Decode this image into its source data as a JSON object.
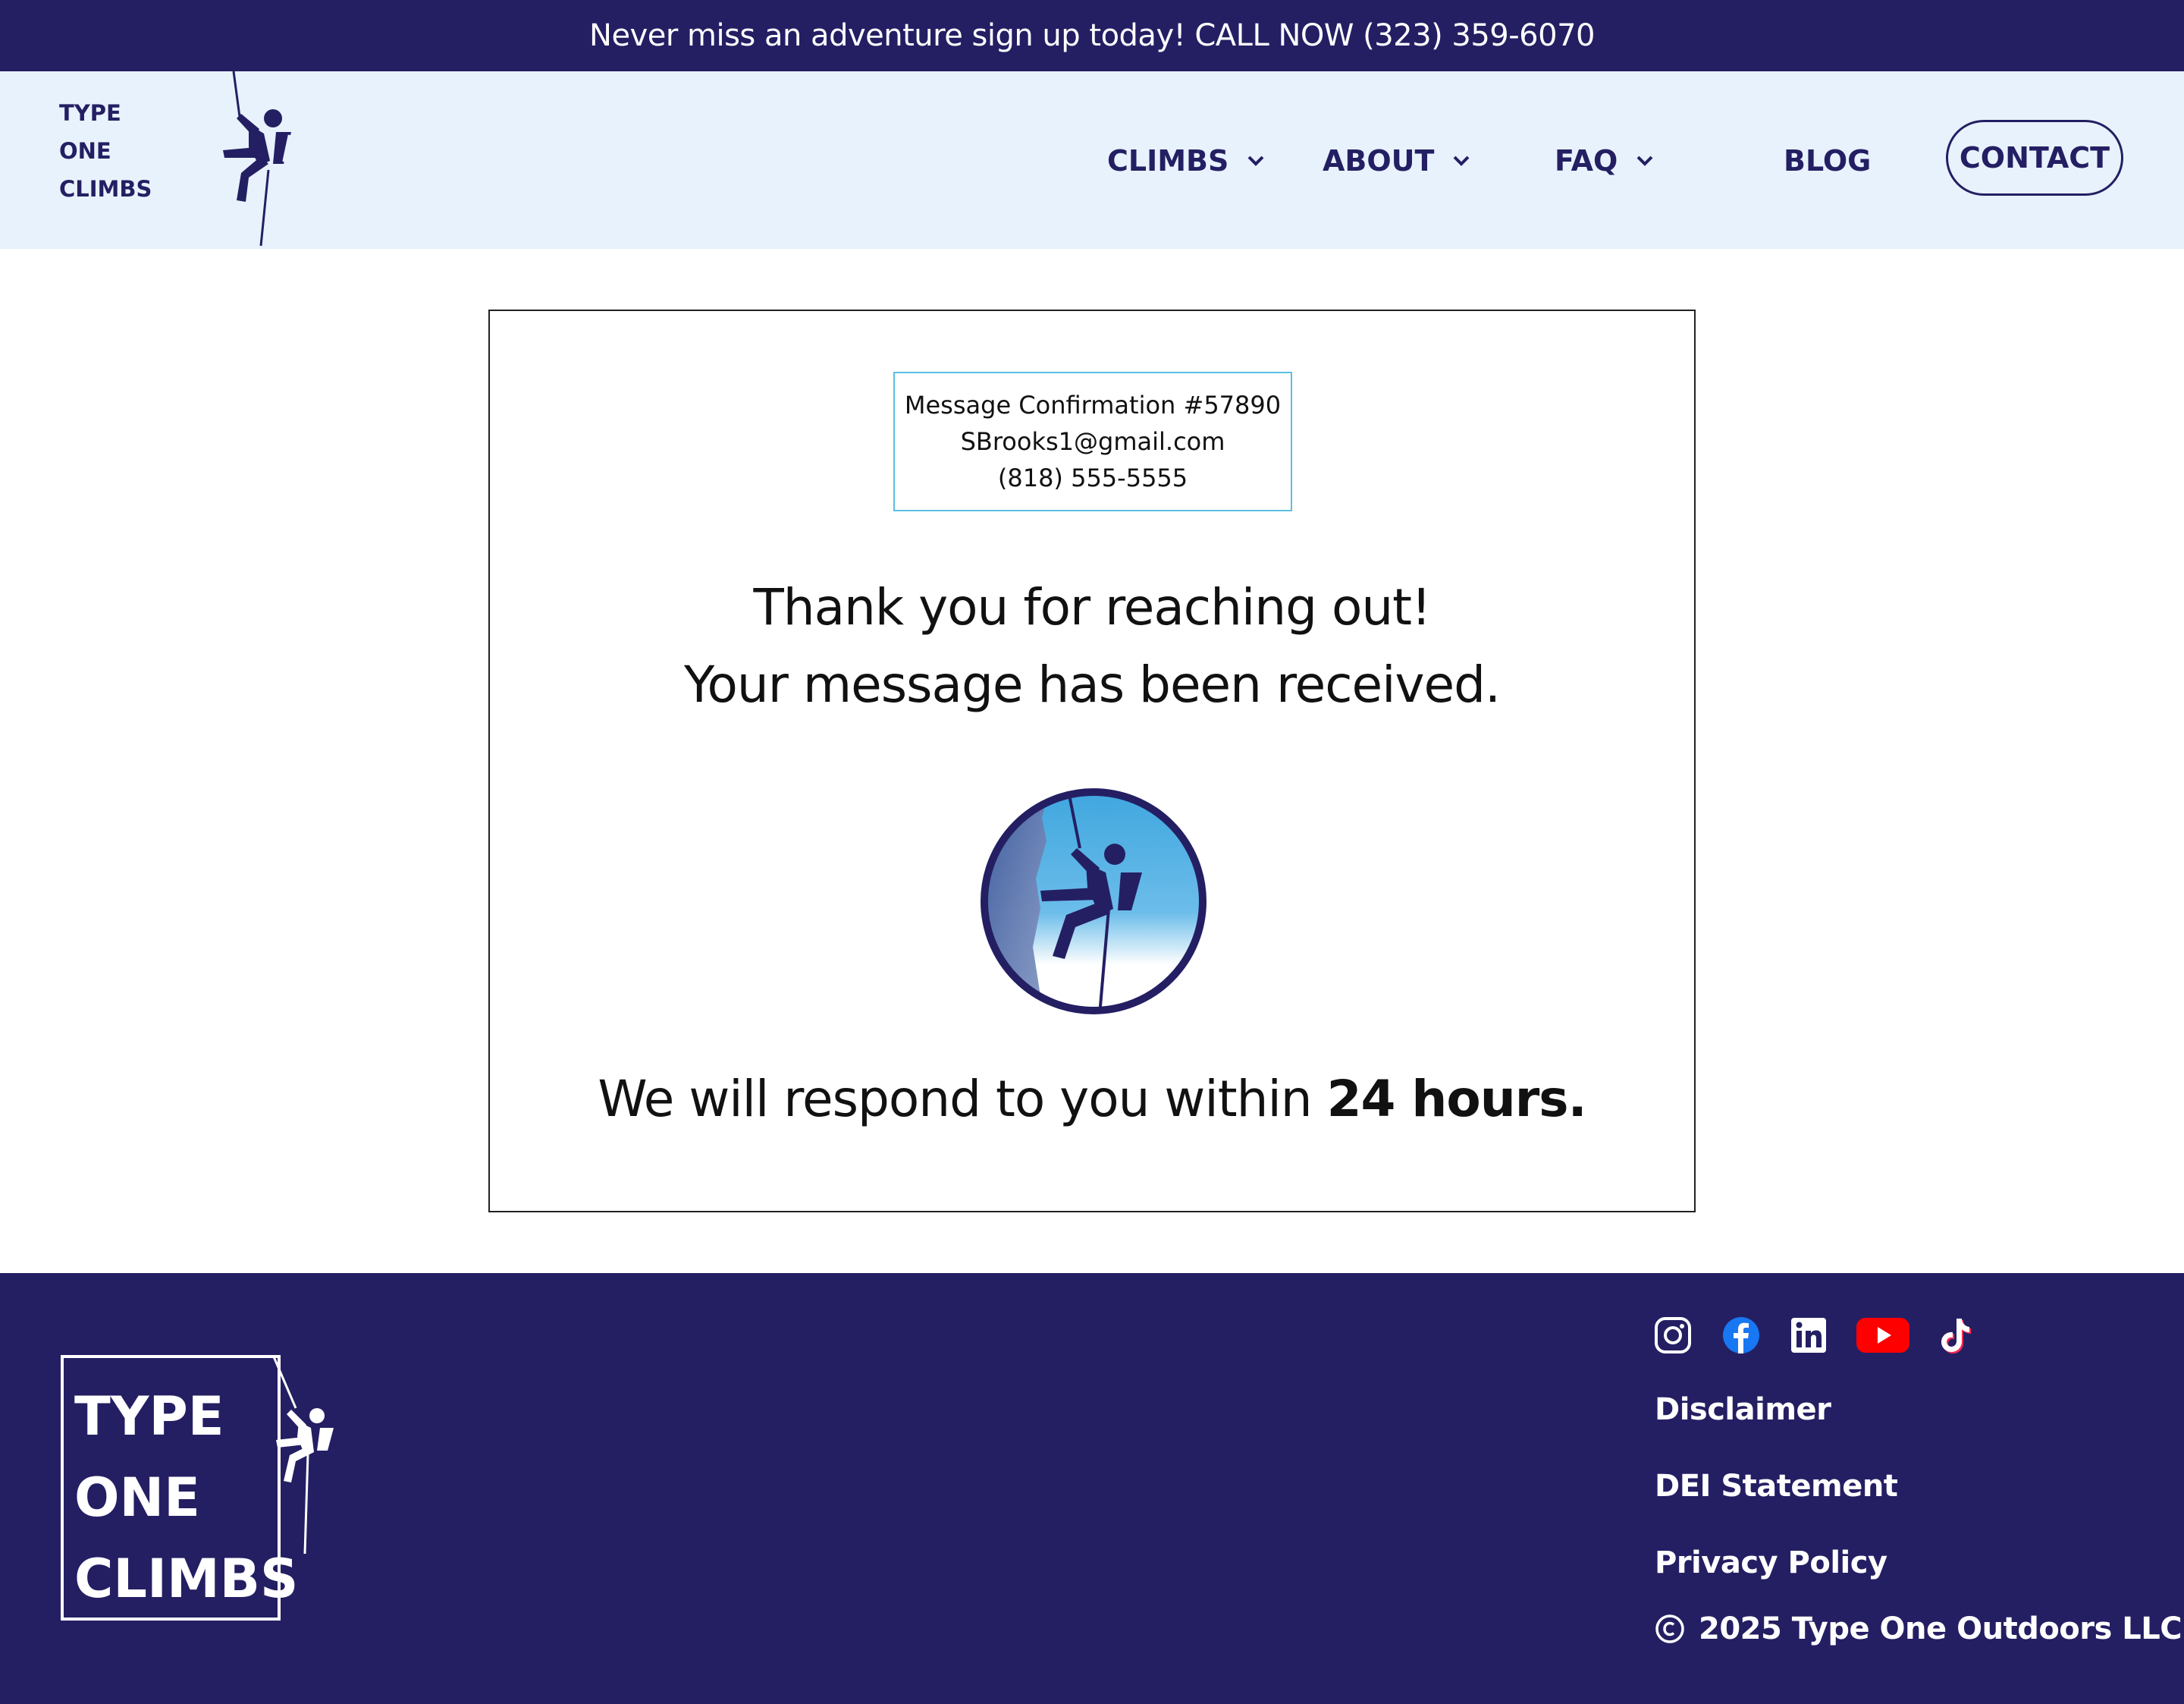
{
  "announcement": "Never miss an adventure sign up today! CALL NOW (323) 359-6070",
  "logo": {
    "line1": "TYPE",
    "line2": "ONE",
    "line3": "CLIMBS"
  },
  "nav": {
    "climbs": "CLIMBS",
    "about": "ABOUT",
    "faq": "FAQ",
    "blog": "BLOG",
    "contact": "CONTACT"
  },
  "confirmation": {
    "number": "Message Confirmation #57890",
    "email": "SBrooks1@gmail.com",
    "phone": "(818) 555-5555"
  },
  "message": {
    "line1": "Thank you for reaching out!",
    "line2": "Your message has been received.",
    "respond_prefix": "We will respond to you within ",
    "respond_bold": "24 hours."
  },
  "footer": {
    "logo": {
      "line1": "TYPE",
      "line2": "ONE",
      "line3": "CLIMBS"
    },
    "social": [
      "instagram-icon",
      "facebook-icon",
      "linkedin-icon",
      "youtube-icon",
      "tiktok-icon"
    ],
    "links": {
      "disclaimer": "Disclaimer",
      "dei": "DEI Statement",
      "privacy": "Privacy Policy"
    },
    "copyright": "2025 Type One Outdoors LLC"
  },
  "colors": {
    "brand_navy": "#241f63",
    "header_bg": "#e8f2fc",
    "confirm_border": "#5bc0e0",
    "youtube_red": "#ff0000",
    "facebook_blue": "#1877f2"
  }
}
